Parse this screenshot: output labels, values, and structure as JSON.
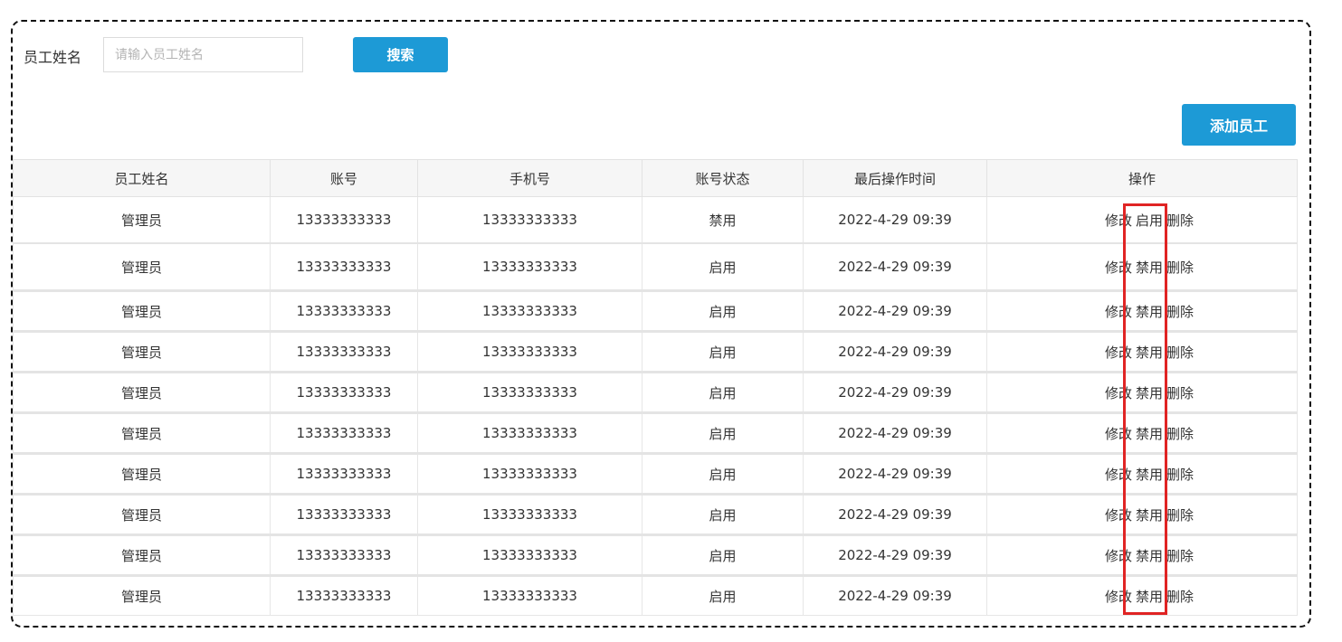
{
  "search": {
    "label": "员工姓名",
    "placeholder": "请输入员工姓名",
    "value": "",
    "button_label": "搜索"
  },
  "toolbar": {
    "add_label": "添加员工"
  },
  "table": {
    "headers": [
      "员工姓名",
      "账号",
      "手机号",
      "账号状态",
      "最后操作时间",
      "操作"
    ],
    "rows": [
      {
        "name": "管理员",
        "account": "13333333333",
        "phone": "13333333333",
        "status": "禁用",
        "time": "2022-4-29 09:39",
        "edit": "修改",
        "toggle": "启用",
        "delete": "删除"
      },
      {
        "name": "管理员",
        "account": "13333333333",
        "phone": "13333333333",
        "status": "启用",
        "time": "2022-4-29 09:39",
        "edit": "修改",
        "toggle": "禁用",
        "delete": "删除"
      },
      {
        "name": "管理员",
        "account": "13333333333",
        "phone": "13333333333",
        "status": "启用",
        "time": "2022-4-29 09:39",
        "edit": "修改",
        "toggle": "禁用",
        "delete": "删除"
      },
      {
        "name": "管理员",
        "account": "13333333333",
        "phone": "13333333333",
        "status": "启用",
        "time": "2022-4-29 09:39",
        "edit": "修改",
        "toggle": "禁用",
        "delete": "删除"
      },
      {
        "name": "管理员",
        "account": "13333333333",
        "phone": "13333333333",
        "status": "启用",
        "time": "2022-4-29 09:39",
        "edit": "修改",
        "toggle": "禁用",
        "delete": "删除"
      },
      {
        "name": "管理员",
        "account": "13333333333",
        "phone": "13333333333",
        "status": "启用",
        "time": "2022-4-29 09:39",
        "edit": "修改",
        "toggle": "禁用",
        "delete": "删除"
      },
      {
        "name": "管理员",
        "account": "13333333333",
        "phone": "13333333333",
        "status": "启用",
        "time": "2022-4-29 09:39",
        "edit": "修改",
        "toggle": "禁用",
        "delete": "删除"
      },
      {
        "name": "管理员",
        "account": "13333333333",
        "phone": "13333333333",
        "status": "启用",
        "time": "2022-4-29 09:39",
        "edit": "修改",
        "toggle": "禁用",
        "delete": "删除"
      },
      {
        "name": "管理员",
        "account": "13333333333",
        "phone": "13333333333",
        "status": "启用",
        "time": "2022-4-29 09:39",
        "edit": "修改",
        "toggle": "禁用",
        "delete": "删除"
      },
      {
        "name": "管理员",
        "account": "13333333333",
        "phone": "13333333333",
        "status": "启用",
        "time": "2022-4-29 09:39",
        "edit": "修改",
        "toggle": "禁用",
        "delete": "删除"
      }
    ]
  },
  "colors": {
    "primary_button": "#1d9ad6",
    "highlight": "#e02424"
  }
}
